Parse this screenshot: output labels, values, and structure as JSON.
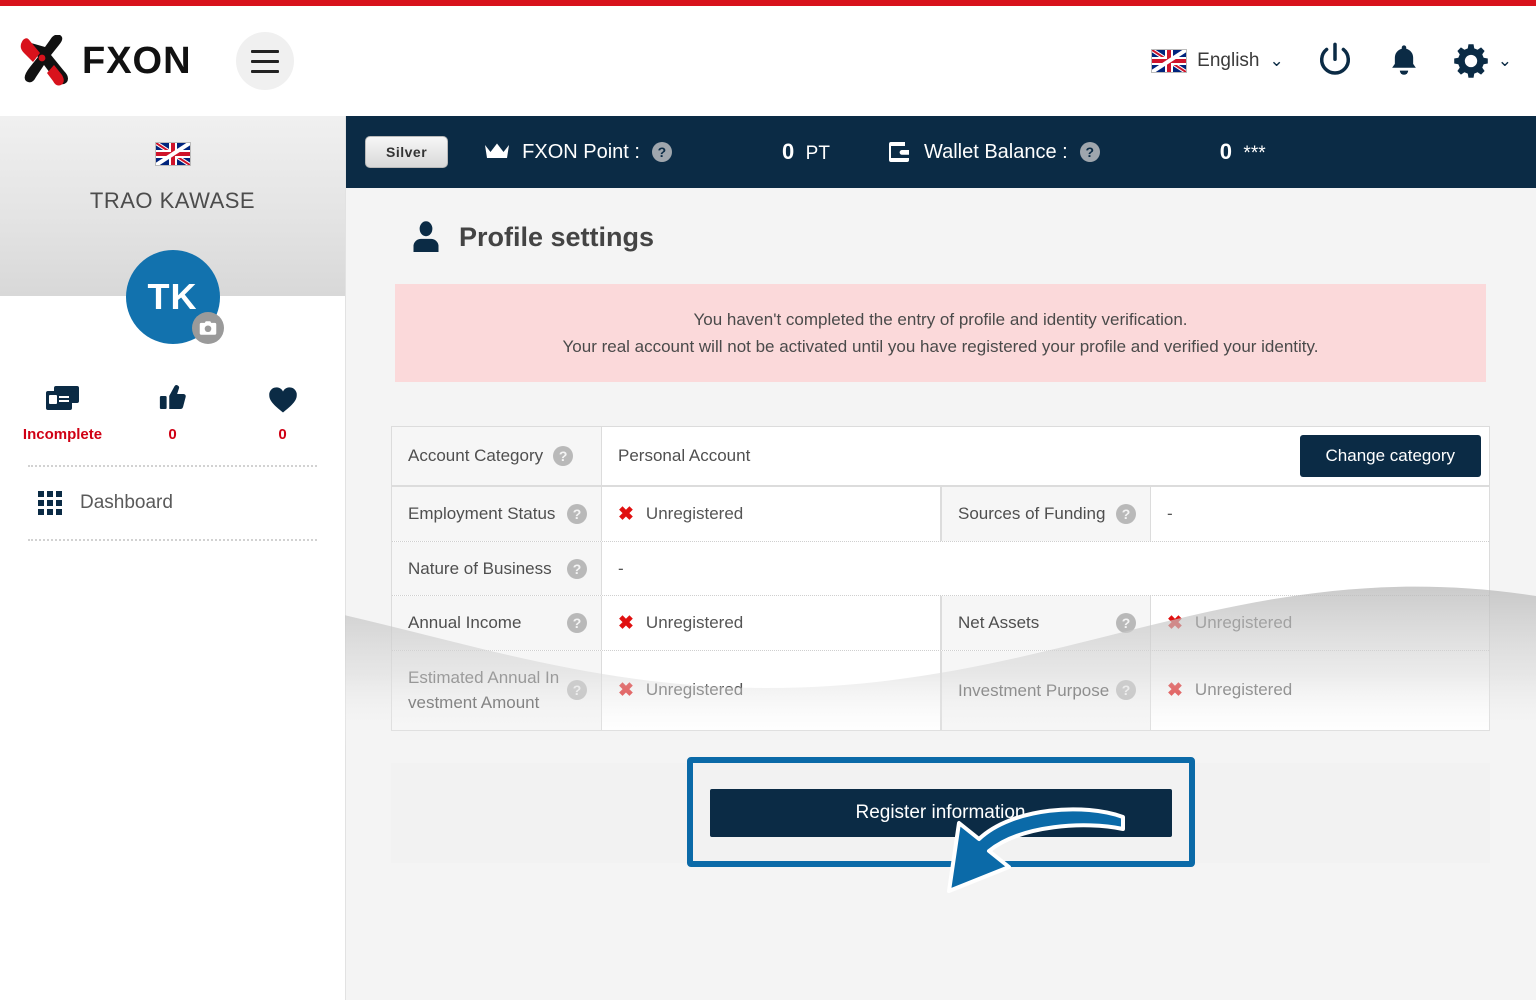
{
  "brand": {
    "logo_text": "FXON"
  },
  "header": {
    "menu_icon": "hamburger-icon",
    "language": {
      "label": "English",
      "flag": "uk-flag",
      "chevron": "⌄"
    },
    "power_icon": "power-icon",
    "bell_icon": "bell-icon",
    "gear_icon": "gear-icon",
    "gear_chevron": "⌄"
  },
  "sidebar": {
    "flag": "uk-flag",
    "user_name": "TRAO KAWASE",
    "avatar_initials": "TK",
    "camera_badge": "camera-icon",
    "stats": [
      {
        "icon": "id-card-icon",
        "label": "Incomplete"
      },
      {
        "icon": "thumbs-up-icon",
        "label": "0"
      },
      {
        "icon": "heart-icon",
        "label": "0"
      }
    ],
    "nav": [
      {
        "icon": "grid-icon",
        "label": "Dashboard"
      }
    ]
  },
  "topbar": {
    "rank_badge": "Silver",
    "point_icon": "crown-icon",
    "point_label": "FXON Point :",
    "point_help": "?",
    "point_value": "0",
    "point_unit": "PT",
    "wallet_icon": "wallet-icon",
    "wallet_label": "Wallet Balance :",
    "wallet_help": "?",
    "wallet_value": "0",
    "wallet_unit": "***"
  },
  "main": {
    "page_icon": "person-icon",
    "page_title": "Profile settings",
    "alert": {
      "line1": "You haven't completed the entry of profile and identity verification.",
      "line2": "Your real account will not be activated until you have registered your profile and verified your identity."
    },
    "account_category": {
      "label": "Account Category",
      "help": "?",
      "value": "Personal Account",
      "button": "Change category"
    },
    "table": {
      "rows": [
        {
          "left_label": "Employment Status",
          "left_help": "?",
          "left_value": "Unregistered",
          "left_status": "unregistered",
          "right_label": "Sources of Funding",
          "right_help": "?",
          "right_value": "-",
          "right_status": "none"
        },
        {
          "left_label": "Nature of Business",
          "left_help": "?",
          "left_value": "-",
          "left_status": "none",
          "right_label": "",
          "right_help": "",
          "right_value": "",
          "right_status": "none"
        },
        {
          "left_label": "Annual Income",
          "left_help": "?",
          "left_value": "Unregistered",
          "left_status": "unregistered",
          "right_label": "Net Assets",
          "right_help": "?",
          "right_value": "Unregistered",
          "right_status": "unregistered"
        },
        {
          "left_label": "Estimated Annual Investment Amount",
          "left_help": "?",
          "left_value": "Unregistered",
          "left_status": "unregistered",
          "right_label": "Investment Purpose",
          "right_help": "?",
          "right_value": "Unregistered",
          "right_status": "unregistered"
        }
      ],
      "x_mark": "✖"
    },
    "register_button": "Register information",
    "annotation": {
      "arrow": "curved-arrow-down-left",
      "highlight": "highlight-rectangle"
    }
  },
  "colors": {
    "brand_red": "#d8121c",
    "navy": "#0b2b45",
    "accent_blue": "#0b6aa8",
    "alert_bg": "#fbd9da",
    "status_red": "#d00014",
    "x_red": "#e01010"
  }
}
